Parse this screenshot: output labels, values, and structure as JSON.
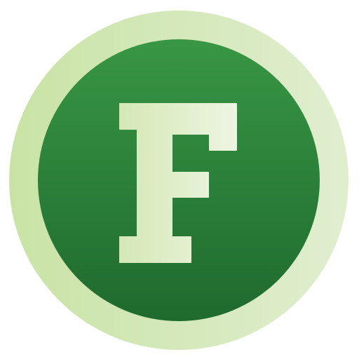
{
  "icon": {
    "letter": "F",
    "colors": {
      "outer_ring_light": "#dcebc6",
      "outer_ring_dark": "#c7e2a2",
      "inner_circle_top": "#379543",
      "inner_circle_bottom": "#1f6b2f",
      "letter_fill_light": "#eef6e0",
      "letter_fill_dark": "#d6e9bb",
      "background": "#ffffff"
    }
  }
}
